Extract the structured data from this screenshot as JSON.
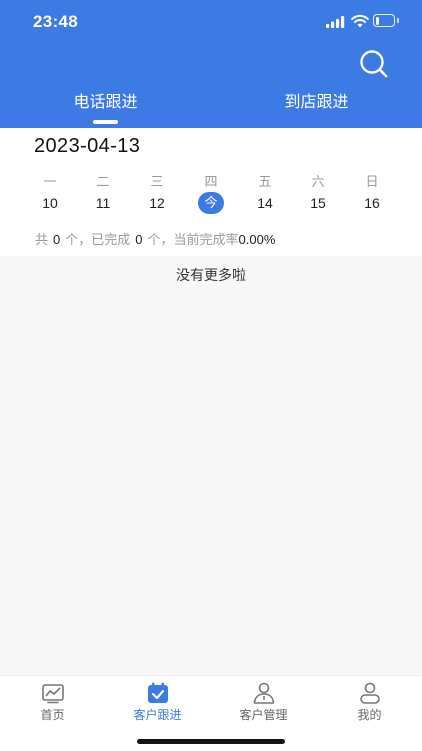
{
  "status_bar": {
    "time": "23:48",
    "battery": "23"
  },
  "header": {
    "tabs": [
      {
        "label": "电话跟进",
        "active": true
      },
      {
        "label": "到店跟进",
        "active": false
      }
    ],
    "search_icon": "search-icon"
  },
  "calendar": {
    "date": "2023-04-13",
    "days": [
      {
        "weekday": "一",
        "day": "10"
      },
      {
        "weekday": "二",
        "day": "11"
      },
      {
        "weekday": "三",
        "day": "12"
      },
      {
        "weekday": "四",
        "day": "今",
        "today": true
      },
      {
        "weekday": "五",
        "day": "14"
      },
      {
        "weekday": "六",
        "day": "15"
      },
      {
        "weekday": "日",
        "day": "16"
      }
    ]
  },
  "stats": {
    "prefix": "共",
    "total": "0",
    "mid": "个，已完成",
    "done": "0",
    "suffix": "个，当前完成率",
    "rate": "0.00%"
  },
  "list": {
    "empty_text": "没有更多啦"
  },
  "bottom_nav": [
    {
      "label": "首页",
      "icon": "chart-icon",
      "active": false
    },
    {
      "label": "客户跟进",
      "icon": "calendar-check-icon",
      "active": true
    },
    {
      "label": "客户管理",
      "icon": "user-badge-icon",
      "active": false
    },
    {
      "label": "我的",
      "icon": "person-icon",
      "active": false
    }
  ],
  "colors": {
    "primary": "#3d7be4",
    "background": "#f7f7f7"
  }
}
